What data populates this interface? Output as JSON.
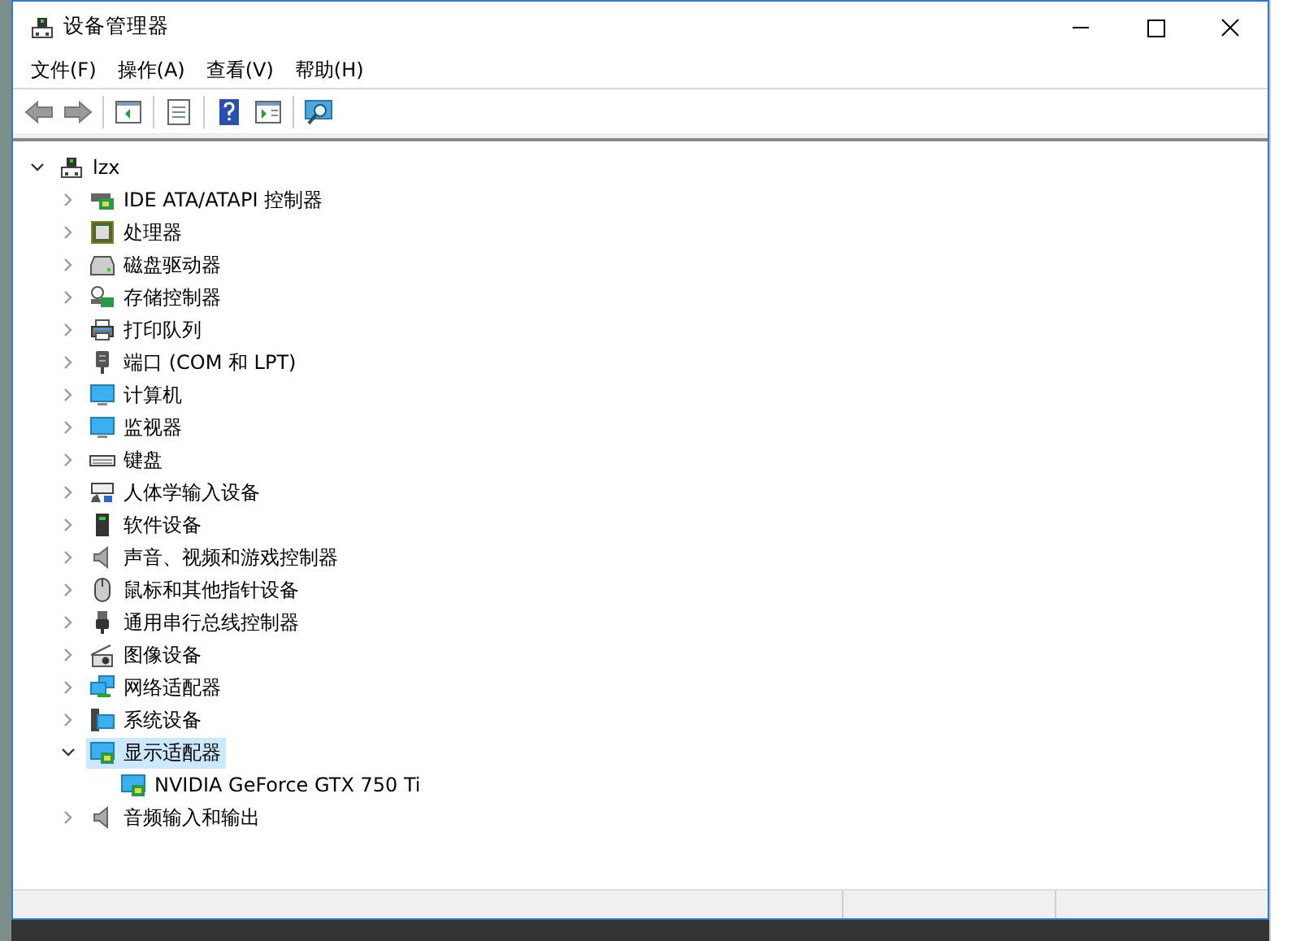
{
  "window": {
    "title": "设备管理器"
  },
  "menu": [
    {
      "label": "文件(F)"
    },
    {
      "label": "操作(A)"
    },
    {
      "label": "查看(V)"
    },
    {
      "label": "帮助(H)"
    }
  ],
  "tree": {
    "label": "lzx",
    "kind": "root",
    "expanded": true,
    "selected": false,
    "children": [
      {
        "label": "IDE ATA/ATAPI 控制器",
        "kind": "ide",
        "expanded": false,
        "selected": false
      },
      {
        "label": "处理器",
        "kind": "cpu",
        "expanded": false,
        "selected": false
      },
      {
        "label": "磁盘驱动器",
        "kind": "disk",
        "expanded": false,
        "selected": false
      },
      {
        "label": "存储控制器",
        "kind": "storage",
        "expanded": false,
        "selected": false
      },
      {
        "label": "打印队列",
        "kind": "printer",
        "expanded": false,
        "selected": false
      },
      {
        "label": "端口 (COM 和 LPT)",
        "kind": "port",
        "expanded": false,
        "selected": false
      },
      {
        "label": "计算机",
        "kind": "computer",
        "expanded": false,
        "selected": false
      },
      {
        "label": "监视器",
        "kind": "monitor",
        "expanded": false,
        "selected": false
      },
      {
        "label": "键盘",
        "kind": "keyboard",
        "expanded": false,
        "selected": false
      },
      {
        "label": "人体学输入设备",
        "kind": "hid",
        "expanded": false,
        "selected": false
      },
      {
        "label": "软件设备",
        "kind": "software",
        "expanded": false,
        "selected": false
      },
      {
        "label": "声音、视频和游戏控制器",
        "kind": "sound",
        "expanded": false,
        "selected": false
      },
      {
        "label": "鼠标和其他指针设备",
        "kind": "mouse",
        "expanded": false,
        "selected": false
      },
      {
        "label": "通用串行总线控制器",
        "kind": "usb",
        "expanded": false,
        "selected": false
      },
      {
        "label": "图像设备",
        "kind": "camera",
        "expanded": false,
        "selected": false
      },
      {
        "label": "网络适配器",
        "kind": "network",
        "expanded": false,
        "selected": false
      },
      {
        "label": "系统设备",
        "kind": "system",
        "expanded": false,
        "selected": false
      },
      {
        "label": "显示适配器",
        "kind": "display",
        "expanded": true,
        "selected": true,
        "children": [
          {
            "label": "NVIDIA GeForce GTX 750 Ti",
            "kind": "display",
            "selected": false
          }
        ]
      },
      {
        "label": "音频输入和输出",
        "kind": "sound",
        "expanded": false,
        "selected": false
      }
    ]
  }
}
